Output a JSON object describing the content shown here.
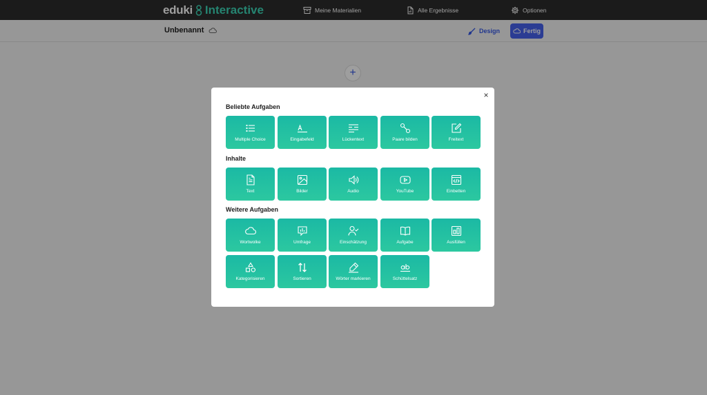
{
  "nav": {
    "brand_left": "eduki",
    "brand_right": "Interactive",
    "links": [
      "Meine Materialien",
      "Alle Ergebnisse",
      "Optionen"
    ]
  },
  "doc": {
    "title": "Unbenannt",
    "design_label": "Design",
    "done_label": "Fertig"
  },
  "add_label": "+",
  "modal": {
    "close": "×",
    "sections": [
      {
        "title": "Beliebte Aufgaben",
        "items": [
          {
            "label": "Multiple Choice",
            "icon": "list-icon"
          },
          {
            "label": "Eingabefeld",
            "icon": "input-field-icon"
          },
          {
            "label": "Lückentext",
            "icon": "gap-text-icon"
          },
          {
            "label": "Paare bilden",
            "icon": "pairs-icon"
          },
          {
            "label": "Freitext",
            "icon": "edit-icon"
          }
        ]
      },
      {
        "title": "Inhalte",
        "items": [
          {
            "label": "Text",
            "icon": "document-icon"
          },
          {
            "label": "Bilder",
            "icon": "image-icon"
          },
          {
            "label": "Audio",
            "icon": "speaker-icon"
          },
          {
            "label": "YouTube",
            "icon": "play-icon"
          },
          {
            "label": "Einbetten",
            "icon": "embed-icon"
          }
        ]
      },
      {
        "title": "Weitere Aufgaben",
        "items": [
          {
            "label": "Wortwolke",
            "icon": "cloud-icon"
          },
          {
            "label": "Umfrage",
            "icon": "poll-icon"
          },
          {
            "label": "Einschätzung",
            "icon": "user-check-icon"
          },
          {
            "label": "Aufgabe",
            "icon": "book-icon"
          },
          {
            "label": "Ausfüllen",
            "icon": "fill-icon"
          },
          {
            "label": "Kategorisieren",
            "icon": "shapes-icon"
          },
          {
            "label": "Sortieren",
            "icon": "sort-icon"
          },
          {
            "label": "Wörter markieren",
            "icon": "highlighter-icon"
          },
          {
            "label": "Schüttelsatz",
            "icon": "shuffle-text-icon"
          }
        ]
      }
    ]
  },
  "colors": {
    "tile": "#1bb9a4",
    "accent": "#4662ee",
    "nav_bg": "#2c2c2c",
    "brand_accent": "#3dd6b6"
  }
}
